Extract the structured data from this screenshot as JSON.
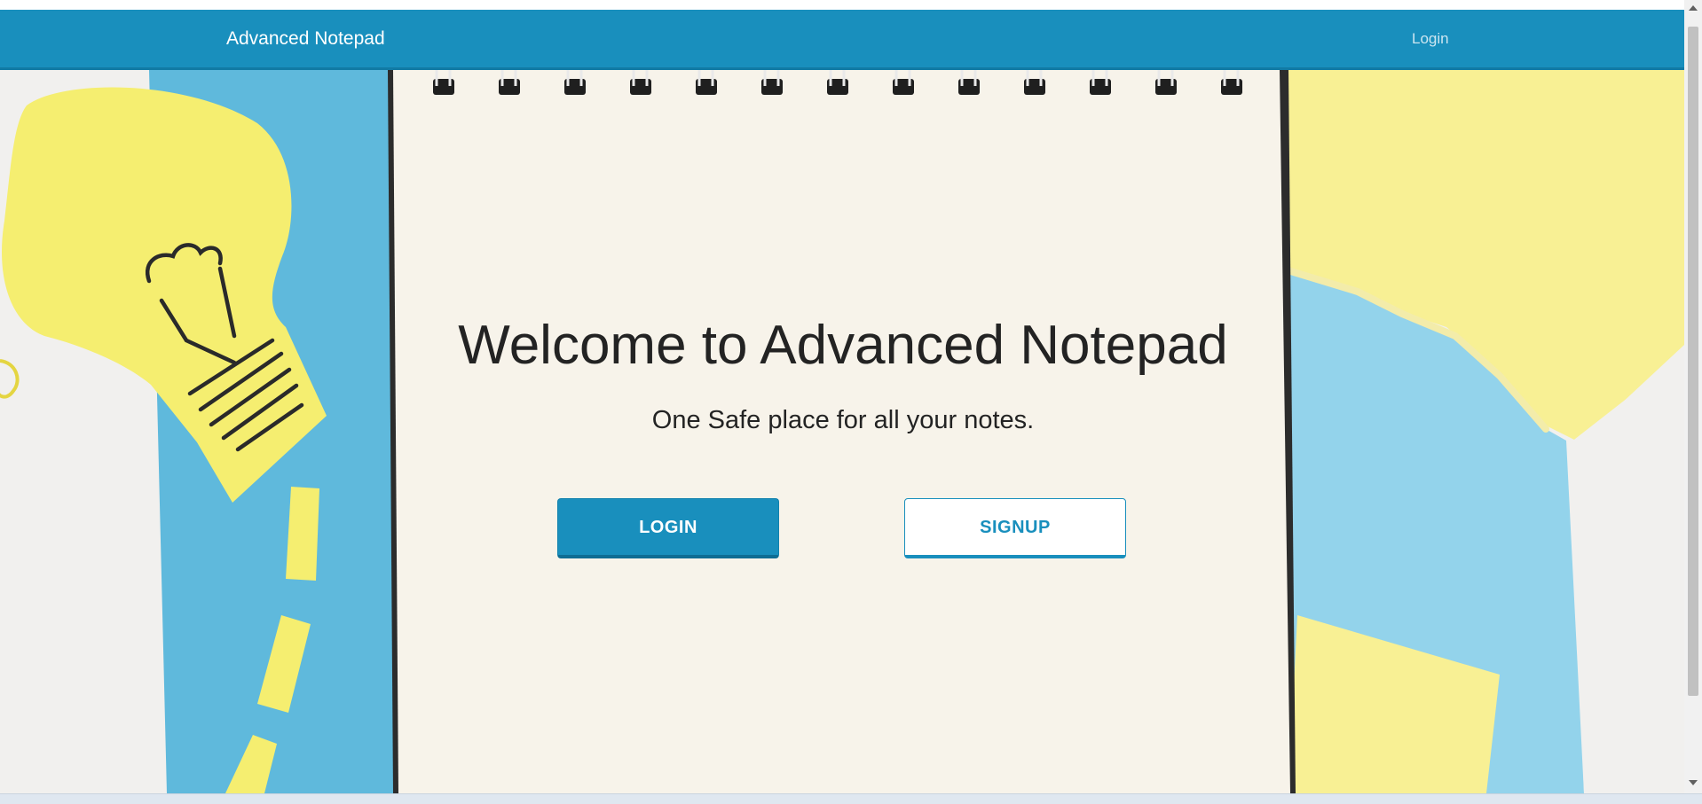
{
  "navbar": {
    "brand": "Advanced Notepad",
    "login_link": "Login",
    "color": "#198fbd"
  },
  "hero": {
    "title": "Welcome to Advanced Notepad",
    "subtitle": "One Safe place for all your notes.",
    "login_button": "LOGIN",
    "signup_button": "SIGNUP",
    "background_image": "notepad-lightbulb-desk"
  },
  "colors": {
    "accent": "#198fbd",
    "paper": "#f7f3ea",
    "sky_blue": "#86cde6",
    "sticky_yellow": "#f3ec73"
  }
}
